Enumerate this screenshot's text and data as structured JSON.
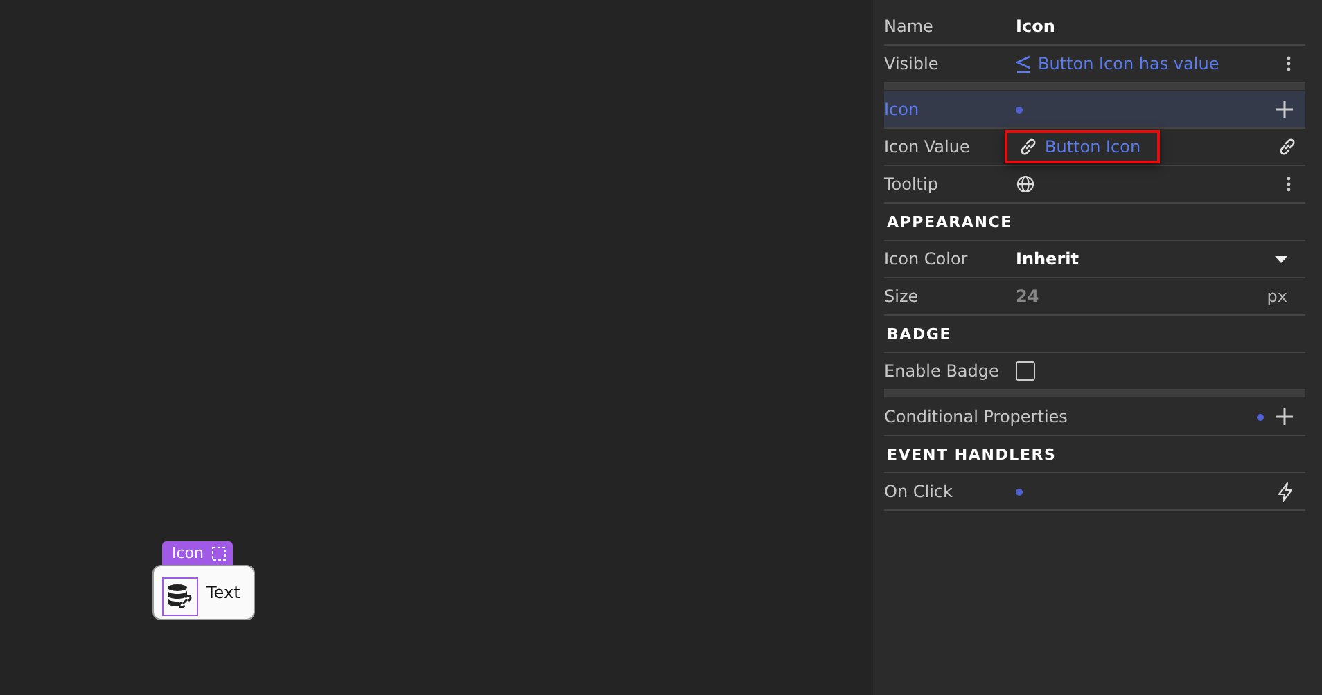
{
  "canvas": {
    "widget": {
      "tag": "Icon",
      "text": "Text",
      "selected": true
    }
  },
  "panel": {
    "sections": [
      [
        {
          "kind": "text",
          "label": "Name",
          "value": "Icon"
        },
        {
          "kind": "condition",
          "label": "Visible",
          "value": "Button Icon has value"
        }
      ],
      [
        {
          "kind": "group",
          "label": "Icon",
          "selected": true,
          "bound": true
        },
        {
          "kind": "link",
          "label": "Icon Value",
          "value": "Button Icon",
          "highlighted": true
        },
        {
          "kind": "tooltip",
          "label": "Tooltip"
        },
        {
          "kind": "heading",
          "label": "APPEARANCE"
        },
        {
          "kind": "select",
          "label": "Icon Color",
          "value": "Inherit"
        },
        {
          "kind": "number",
          "label": "Size",
          "placeholder": "24",
          "unit": "px"
        },
        {
          "kind": "heading",
          "label": "BADGE"
        },
        {
          "kind": "checkbox",
          "label": "Enable Badge",
          "checked": false
        }
      ],
      [
        {
          "kind": "group",
          "label": "Conditional Properties",
          "selected": false,
          "bound": true
        },
        {
          "kind": "heading",
          "label": "EVENT HANDLERS"
        },
        {
          "kind": "event",
          "label": "On Click",
          "bound": true
        }
      ]
    ]
  }
}
